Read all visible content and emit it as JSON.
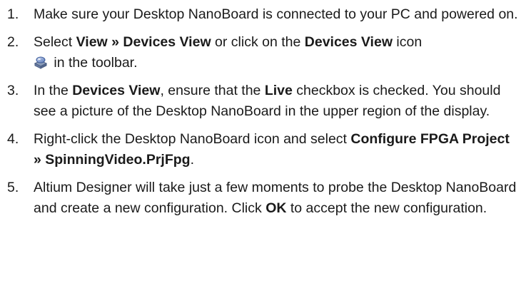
{
  "steps": [
    {
      "num": "1.",
      "t1": "Make sure your Desktop NanoBoard is connected to your PC and powered on."
    },
    {
      "num": "2.",
      "t1": "Select ",
      "b1": "View » Devices View",
      "t2": " or click on the ",
      "b2": "Devices View",
      "t3": " icon",
      "icon": "devices-view-icon",
      "t4": " in the toolbar."
    },
    {
      "num": "3.",
      "t1": "In the ",
      "b1": "Devices View",
      "t2": ", ensure that the ",
      "b2": "Live",
      "t3": " checkbox is checked. You should see a picture of the Desktop NanoBoard in the upper region of the display."
    },
    {
      "num": "4.",
      "t1": "Right-click the Desktop NanoBoard icon and select ",
      "b1": "Configure FPGA Project » SpinningVideo.PrjFpg",
      "t2": "."
    },
    {
      "num": "5.",
      "t1": "Altium Designer will take just a few moments to probe the Desktop NanoBoard and create a new configuration.  Click ",
      "b1": "OK",
      "t2": " to accept the new configuration."
    }
  ]
}
